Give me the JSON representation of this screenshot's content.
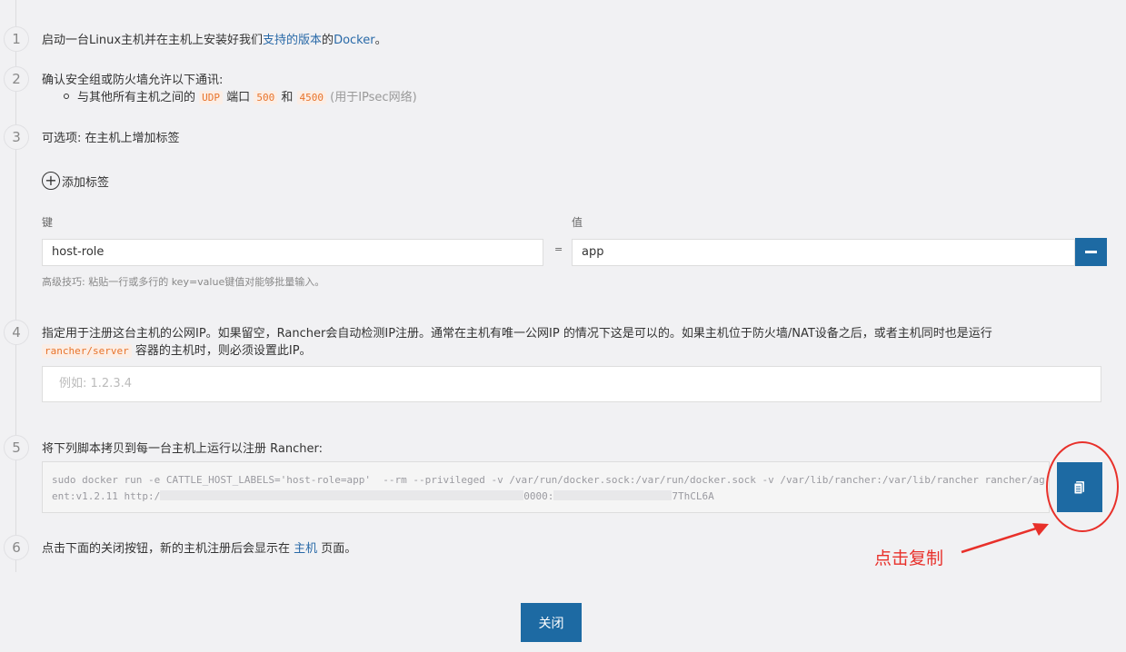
{
  "steps": [
    {
      "num": "1"
    },
    {
      "num": "2"
    },
    {
      "num": "3"
    },
    {
      "num": "4"
    },
    {
      "num": "5"
    },
    {
      "num": "6"
    }
  ],
  "step1": {
    "pre": "启动一台Linux主机并在主机上安装好我们",
    "link1": "支持的版本",
    "mid": "的",
    "link2": "Docker",
    "post": "。"
  },
  "step2": {
    "title": "确认安全组或防火墙允许以下通讯:",
    "bullet_pre": "与其他所有主机之间的",
    "proto": "UDP",
    "port_word": "端口",
    "port1": "500",
    "and_word": "和",
    "port2": "4500",
    "note": "(用于IPsec网络)"
  },
  "step3": {
    "title": "可选项: 在主机上增加标签",
    "add_label": "添加标签",
    "key_label": "键",
    "value_label": "值",
    "key_value": "host-role",
    "eq": "=",
    "value_value": "app",
    "hint": "高级技巧: 粘贴一行或多行的 key=value键值对能够批量输入。"
  },
  "step4": {
    "line1": "指定用于注册这台主机的公网IP。如果留空，Rancher会自动检测IP注册。通常在主机有唯一公网IP 的情况下这是可以的。如果主机位于防火墙/NAT设备之后，或者主机同时也是运行",
    "code": "rancher/server",
    "line2": "容器的主机时，则必须设置此IP。",
    "placeholder": "例如: 1.2.3.4"
  },
  "step5": {
    "title": "将下列脚本拷贝到每一台主机上运行以注册 Rancher:",
    "script_line1": "sudo docker run -e CATTLE_HOST_LABELS='host-role=app'  --rm --privileged -v /var/run/docker.sock:/var/run/docker.sock -v /var/lib/rancher:/var/lib/rancher rancher/ag",
    "script_line2_a": "ent:v1.2.11 http:/",
    "script_line2_b": "0000:",
    "script_line2_c": "7ThCL6A"
  },
  "step6": {
    "pre": "点击下面的关闭按钮，新的主机注册后会显示在 ",
    "link": "主机",
    "post": " 页面。"
  },
  "annotation": "点击复制",
  "close_label": "关闭"
}
